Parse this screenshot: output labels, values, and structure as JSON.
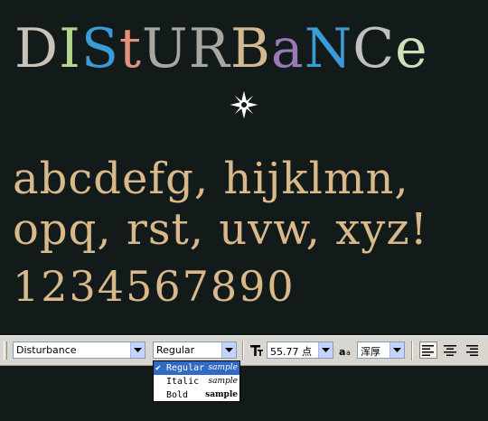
{
  "preview": {
    "title_letters": [
      {
        "ch": "D",
        "color": "#c9c2b8"
      },
      {
        "ch": "I",
        "color": "#b5d48e"
      },
      {
        "ch": "S",
        "color": "#3a9bd6"
      },
      {
        "ch": "t",
        "color": "#e3907c"
      },
      {
        "ch": "U",
        "color": "#a8a8a0"
      },
      {
        "ch": "R",
        "color": "#a8a8a0"
      },
      {
        "ch": "B",
        "color": "#d3b98d"
      },
      {
        "ch": "a",
        "color": "#9b79b8"
      },
      {
        "ch": "N",
        "color": "#3a9bd6"
      },
      {
        "ch": "C",
        "color": "#c0c0c0"
      },
      {
        "ch": "e",
        "color": "#cfe0b8"
      }
    ],
    "line1": "abcdefg, hijklmn,",
    "line2": "opq, rst, uvw, xyz!",
    "line3": "1234567890",
    "text_color": "#d9b98a",
    "star_icon": "eight-point-star-icon"
  },
  "toolbar": {
    "font_family": "Disturbance",
    "font_style": "Regular",
    "font_size": "55.77 点",
    "antialias": "浑厚",
    "size_icon": "font-size-T-icon",
    "antialias_icon": "aa-icon"
  },
  "style_menu": {
    "options": [
      {
        "name": "Regular",
        "sample": "sample",
        "selected": true
      },
      {
        "name": "Italic",
        "sample": "sample",
        "selected": false
      },
      {
        "name": "Bold",
        "sample": "sample",
        "selected": false
      }
    ],
    "selected_color": "#316ac5"
  }
}
